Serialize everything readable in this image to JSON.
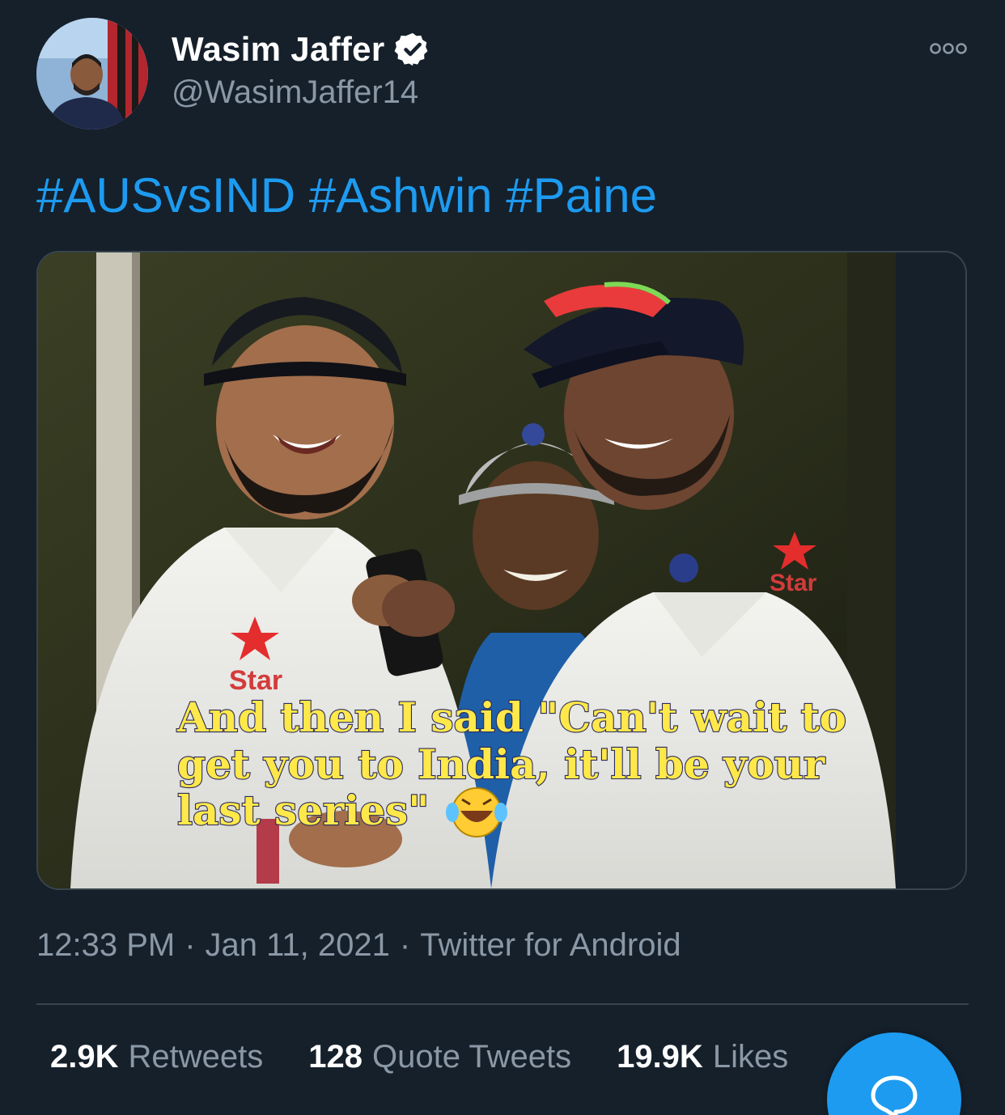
{
  "author": {
    "display_name": "Wasim Jaffer",
    "handle": "@WasimJaffer14",
    "verified": true,
    "avatar_icon": "user-avatar-photo"
  },
  "tweet": {
    "hashtags": [
      "#AUSvsIND",
      "#Ashwin",
      "#Paine"
    ]
  },
  "media": {
    "caption_line1": "And then I said \"Can't wait to",
    "caption_line2": "get you to India, it'll be your",
    "caption_line3": "last series\"",
    "caption_emoji": "😂",
    "shirt_sponsor_left": "Star",
    "shirt_sponsor_right": "Star"
  },
  "meta": {
    "time": "12:33 PM",
    "separator": "·",
    "date": "Jan 11, 2021",
    "source": "Twitter for Android"
  },
  "stats": {
    "retweets_count": "2.9K",
    "retweets_label": "Retweets",
    "quotes_count": "128",
    "quotes_label": "Quote Tweets",
    "likes_count": "19.9K",
    "likes_label": "Likes"
  },
  "colors": {
    "background": "#15202b",
    "accent": "#1d9bf0",
    "secondary_text": "#8b98a5",
    "border": "#38444d",
    "caption_fill": "#ffe84a"
  },
  "icons": {
    "more": "more-options-icon",
    "verified": "verified-badge-icon",
    "compose": "reply-bubble-icon"
  }
}
